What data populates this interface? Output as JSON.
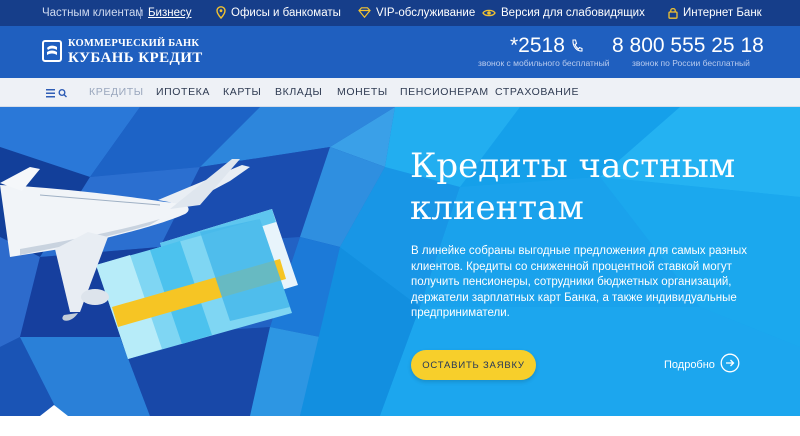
{
  "topbar": {
    "private_label": "Частным клиентам",
    "business_label": "Бизнесу",
    "offices_label": "Офисы и банкоматы",
    "vip_label": "VIP-обслуживание",
    "vision_label": "Версия для слабовидящих",
    "ibank_label": "Интернет Банк"
  },
  "header": {
    "logo_line1": "КОММЕРЧЕСКИЙ БАНК",
    "logo_line2": "КУБАНЬ КРЕДИТ",
    "phone_short": "*2518",
    "phone_short_note": "звонок с мобильного бесплатный",
    "phone_long": "8 800 555 25 18",
    "phone_long_note": "звонок по России бесплатный"
  },
  "nav": {
    "items": [
      "КРЕДИТЫ",
      "ИПОТЕКА",
      "КАРТЫ",
      "ВКЛАДЫ",
      "МОНЕТЫ",
      "ПЕНСИОНЕРАМ",
      "СТРАХОВАНИЕ"
    ]
  },
  "hero": {
    "title": "Кредиты частным клиентам",
    "description": "В линейке собраны выгодные предложения для самых разных клиентов. Кредиты со сниженной процентной ставкой могут получить пенсионеры, сотрудники бюджетных организаций, держатели зарплатных карт Банка, а также индивидуальные предприниматели.",
    "cta_label": "ОСТАВИТЬ ЗАЯВКУ",
    "more_label": "Подробно"
  },
  "colors": {
    "topbar": "#163e8a",
    "header": "#1f5fbf",
    "accent_button": "#f7cf2b",
    "hero_light": "#1ea4ea",
    "hero_dark": "#143f9c"
  }
}
